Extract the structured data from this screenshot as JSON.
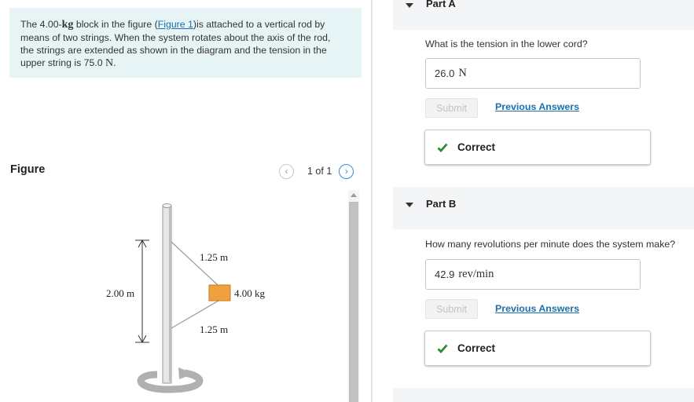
{
  "problem": {
    "line1_a": "The 4.00-",
    "line1_unit": "kg",
    "line1_b": " block in the figure (",
    "figure_link": "Figure 1",
    "line1_c": ")is attached to a vertical rod by",
    "line2": "means of two strings. When the system rotates about the axis of the rod,",
    "line3": "the strings are extended as shown in the diagram and the tension in the",
    "line4_a": "upper string is 75.0 ",
    "line4_unit": "N",
    "line4_b": "."
  },
  "figure": {
    "title": "Figure",
    "pager": {
      "prev_symbol": "‹",
      "next_symbol": "›",
      "count": "1 of 1"
    },
    "labels": {
      "upper": "1.25 m",
      "lower": "1.25 m",
      "height": "2.00 m",
      "mass": "4.00 kg"
    },
    "colors": {
      "block": "#f0a03c",
      "rod": "#e6e6e6"
    }
  },
  "part_a": {
    "label": "Part A",
    "question": "What is the tension in the lower cord?",
    "answer_value": "26.0",
    "answer_unit": "N",
    "submit_label": "Submit",
    "previous_label": "Previous Answers",
    "result": "Correct"
  },
  "part_b": {
    "label": "Part B",
    "question": "How many revolutions per minute does the system make?",
    "answer_value": "42.9",
    "answer_unit": "rev/min",
    "submit_label": "Submit",
    "previous_label": "Previous Answers",
    "result": "Correct"
  },
  "colors": {
    "accent": "#1a6fb0",
    "correct_green": "#2e8b2e",
    "problem_bg": "#e7f4f6"
  }
}
